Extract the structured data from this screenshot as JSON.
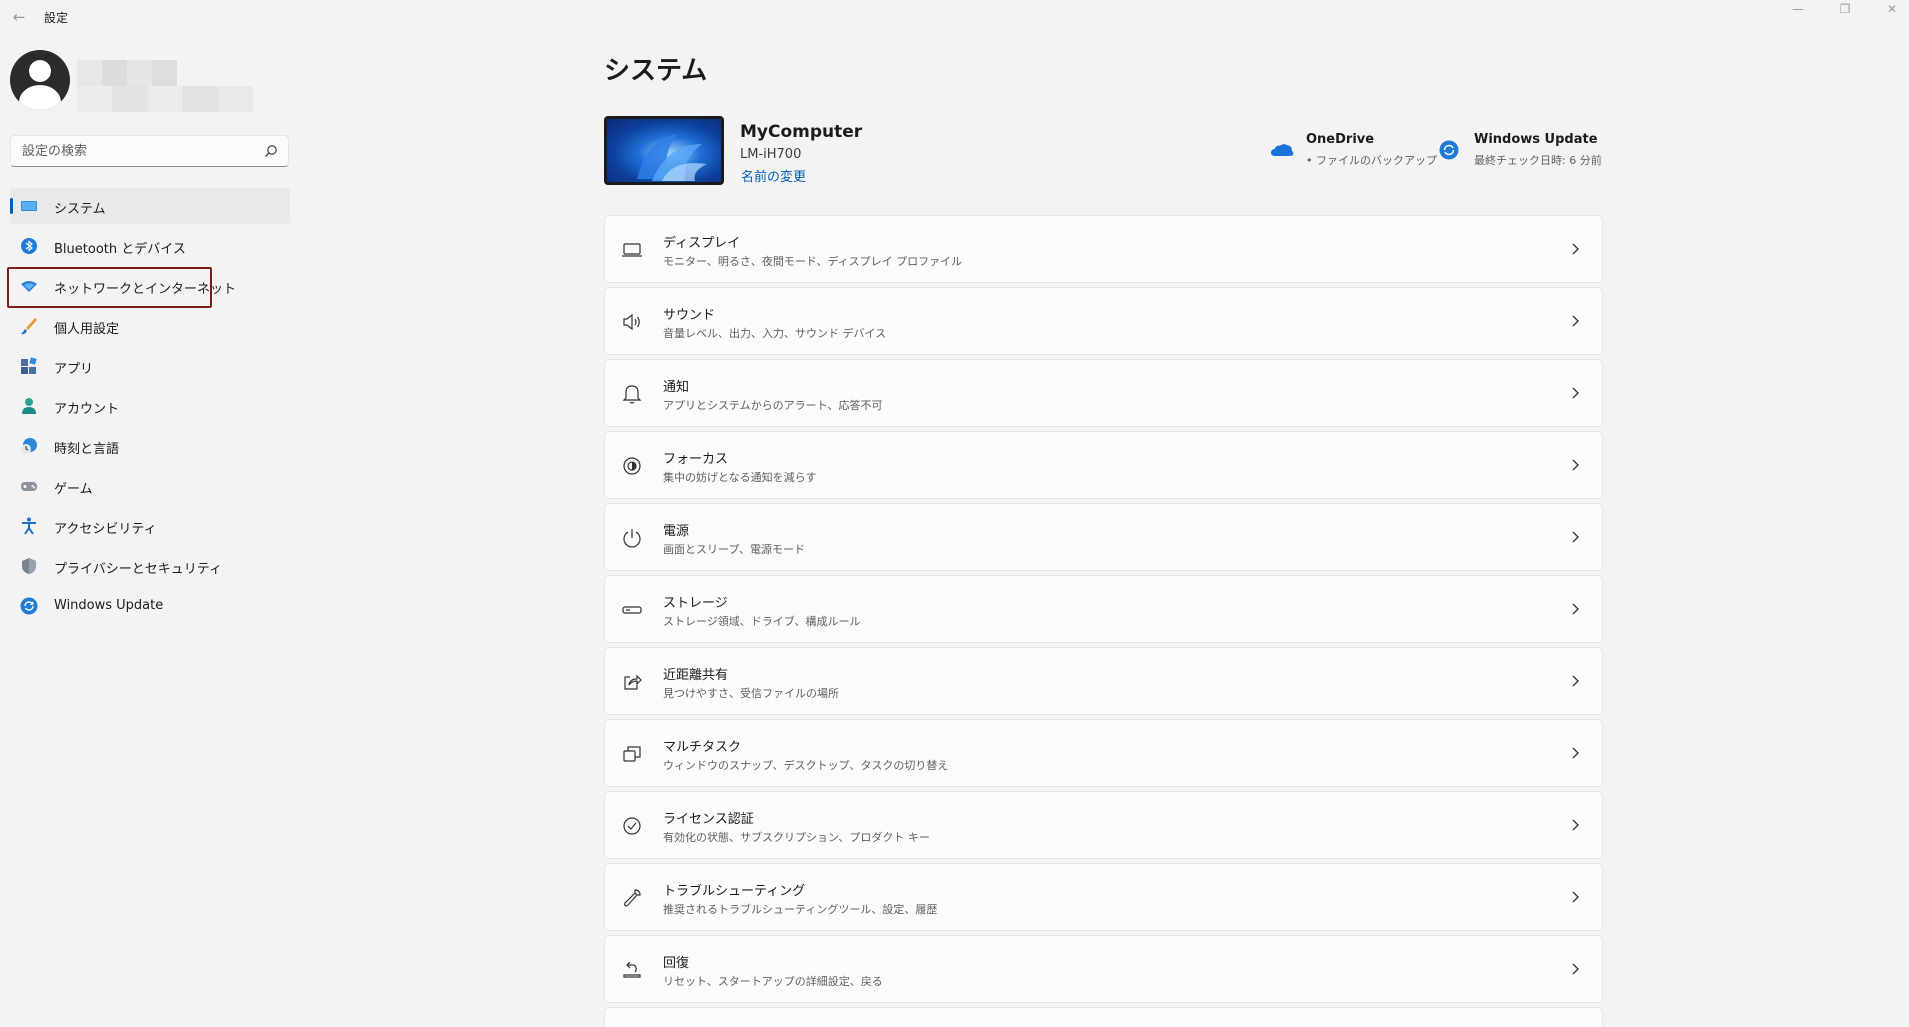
{
  "app": {
    "title": "設定",
    "back_icon": "back-arrow-icon"
  },
  "window_controls": {
    "minimize": "—",
    "maximize": "❐",
    "close": "✕"
  },
  "search": {
    "placeholder": "設定の検索"
  },
  "sidebar": {
    "items": [
      {
        "label": "システム",
        "icon": "system-icon",
        "selected": true
      },
      {
        "label": "Bluetooth とデバイス",
        "icon": "bluetooth-icon"
      },
      {
        "label": "ネットワークとインターネット",
        "icon": "wifi-icon",
        "highlighted": true
      },
      {
        "label": "個人用設定",
        "icon": "brush-icon"
      },
      {
        "label": "アプリ",
        "icon": "apps-icon"
      },
      {
        "label": "アカウント",
        "icon": "account-icon"
      },
      {
        "label": "時刻と言語",
        "icon": "time-language-icon"
      },
      {
        "label": "ゲーム",
        "icon": "gamepad-icon"
      },
      {
        "label": "アクセシビリティ",
        "icon": "accessibility-icon"
      },
      {
        "label": "プライバシーとセキュリティ",
        "icon": "shield-icon"
      },
      {
        "label": "Windows Update",
        "icon": "update-icon"
      }
    ]
  },
  "main": {
    "title": "システム",
    "device": {
      "name": "MyComputer",
      "model": "LM-iH700",
      "rename_link": "名前の変更"
    },
    "status": {
      "onedrive": {
        "title": "OneDrive",
        "sub": "• ファイルのバックアップ"
      },
      "windows_update": {
        "title": "Windows Update",
        "sub": "最終チェック日時: 6 分前"
      }
    },
    "cards": [
      {
        "title": "ディスプレイ",
        "sub": "モニター、明るさ、夜間モード、ディスプレイ プロファイル",
        "icon": "display-icon"
      },
      {
        "title": "サウンド",
        "sub": "音量レベル、出力、入力、サウンド デバイス",
        "icon": "speaker-icon"
      },
      {
        "title": "通知",
        "sub": "アプリとシステムからのアラート、応答不可",
        "icon": "bell-icon"
      },
      {
        "title": "フォーカス",
        "sub": "集中の妨げとなる通知を減らす",
        "icon": "focus-icon"
      },
      {
        "title": "電源",
        "sub": "画面とスリープ、電源モード",
        "icon": "power-icon"
      },
      {
        "title": "ストレージ",
        "sub": "ストレージ領域、ドライブ、構成ルール",
        "icon": "storage-icon"
      },
      {
        "title": "近距離共有",
        "sub": "見つけやすさ、受信ファイルの場所",
        "icon": "share-icon"
      },
      {
        "title": "マルチタスク",
        "sub": "ウィンドウのスナップ、デスクトップ、タスクの切り替え",
        "icon": "multitask-icon"
      },
      {
        "title": "ライセンス認証",
        "sub": "有効化の状態、サブスクリプション、プロダクト キー",
        "icon": "check-circle-icon"
      },
      {
        "title": "トラブルシューティング",
        "sub": "推奨されるトラブルシューティングツール、設定、履歴",
        "icon": "wrench-icon"
      },
      {
        "title": "回復",
        "sub": "リセット、スタートアップの詳細設定、戻る",
        "icon": "recovery-icon"
      }
    ]
  },
  "colors": {
    "accent": "#005fb8",
    "highlight_box": "#7a1c1c",
    "background": "#f3f3f3"
  }
}
